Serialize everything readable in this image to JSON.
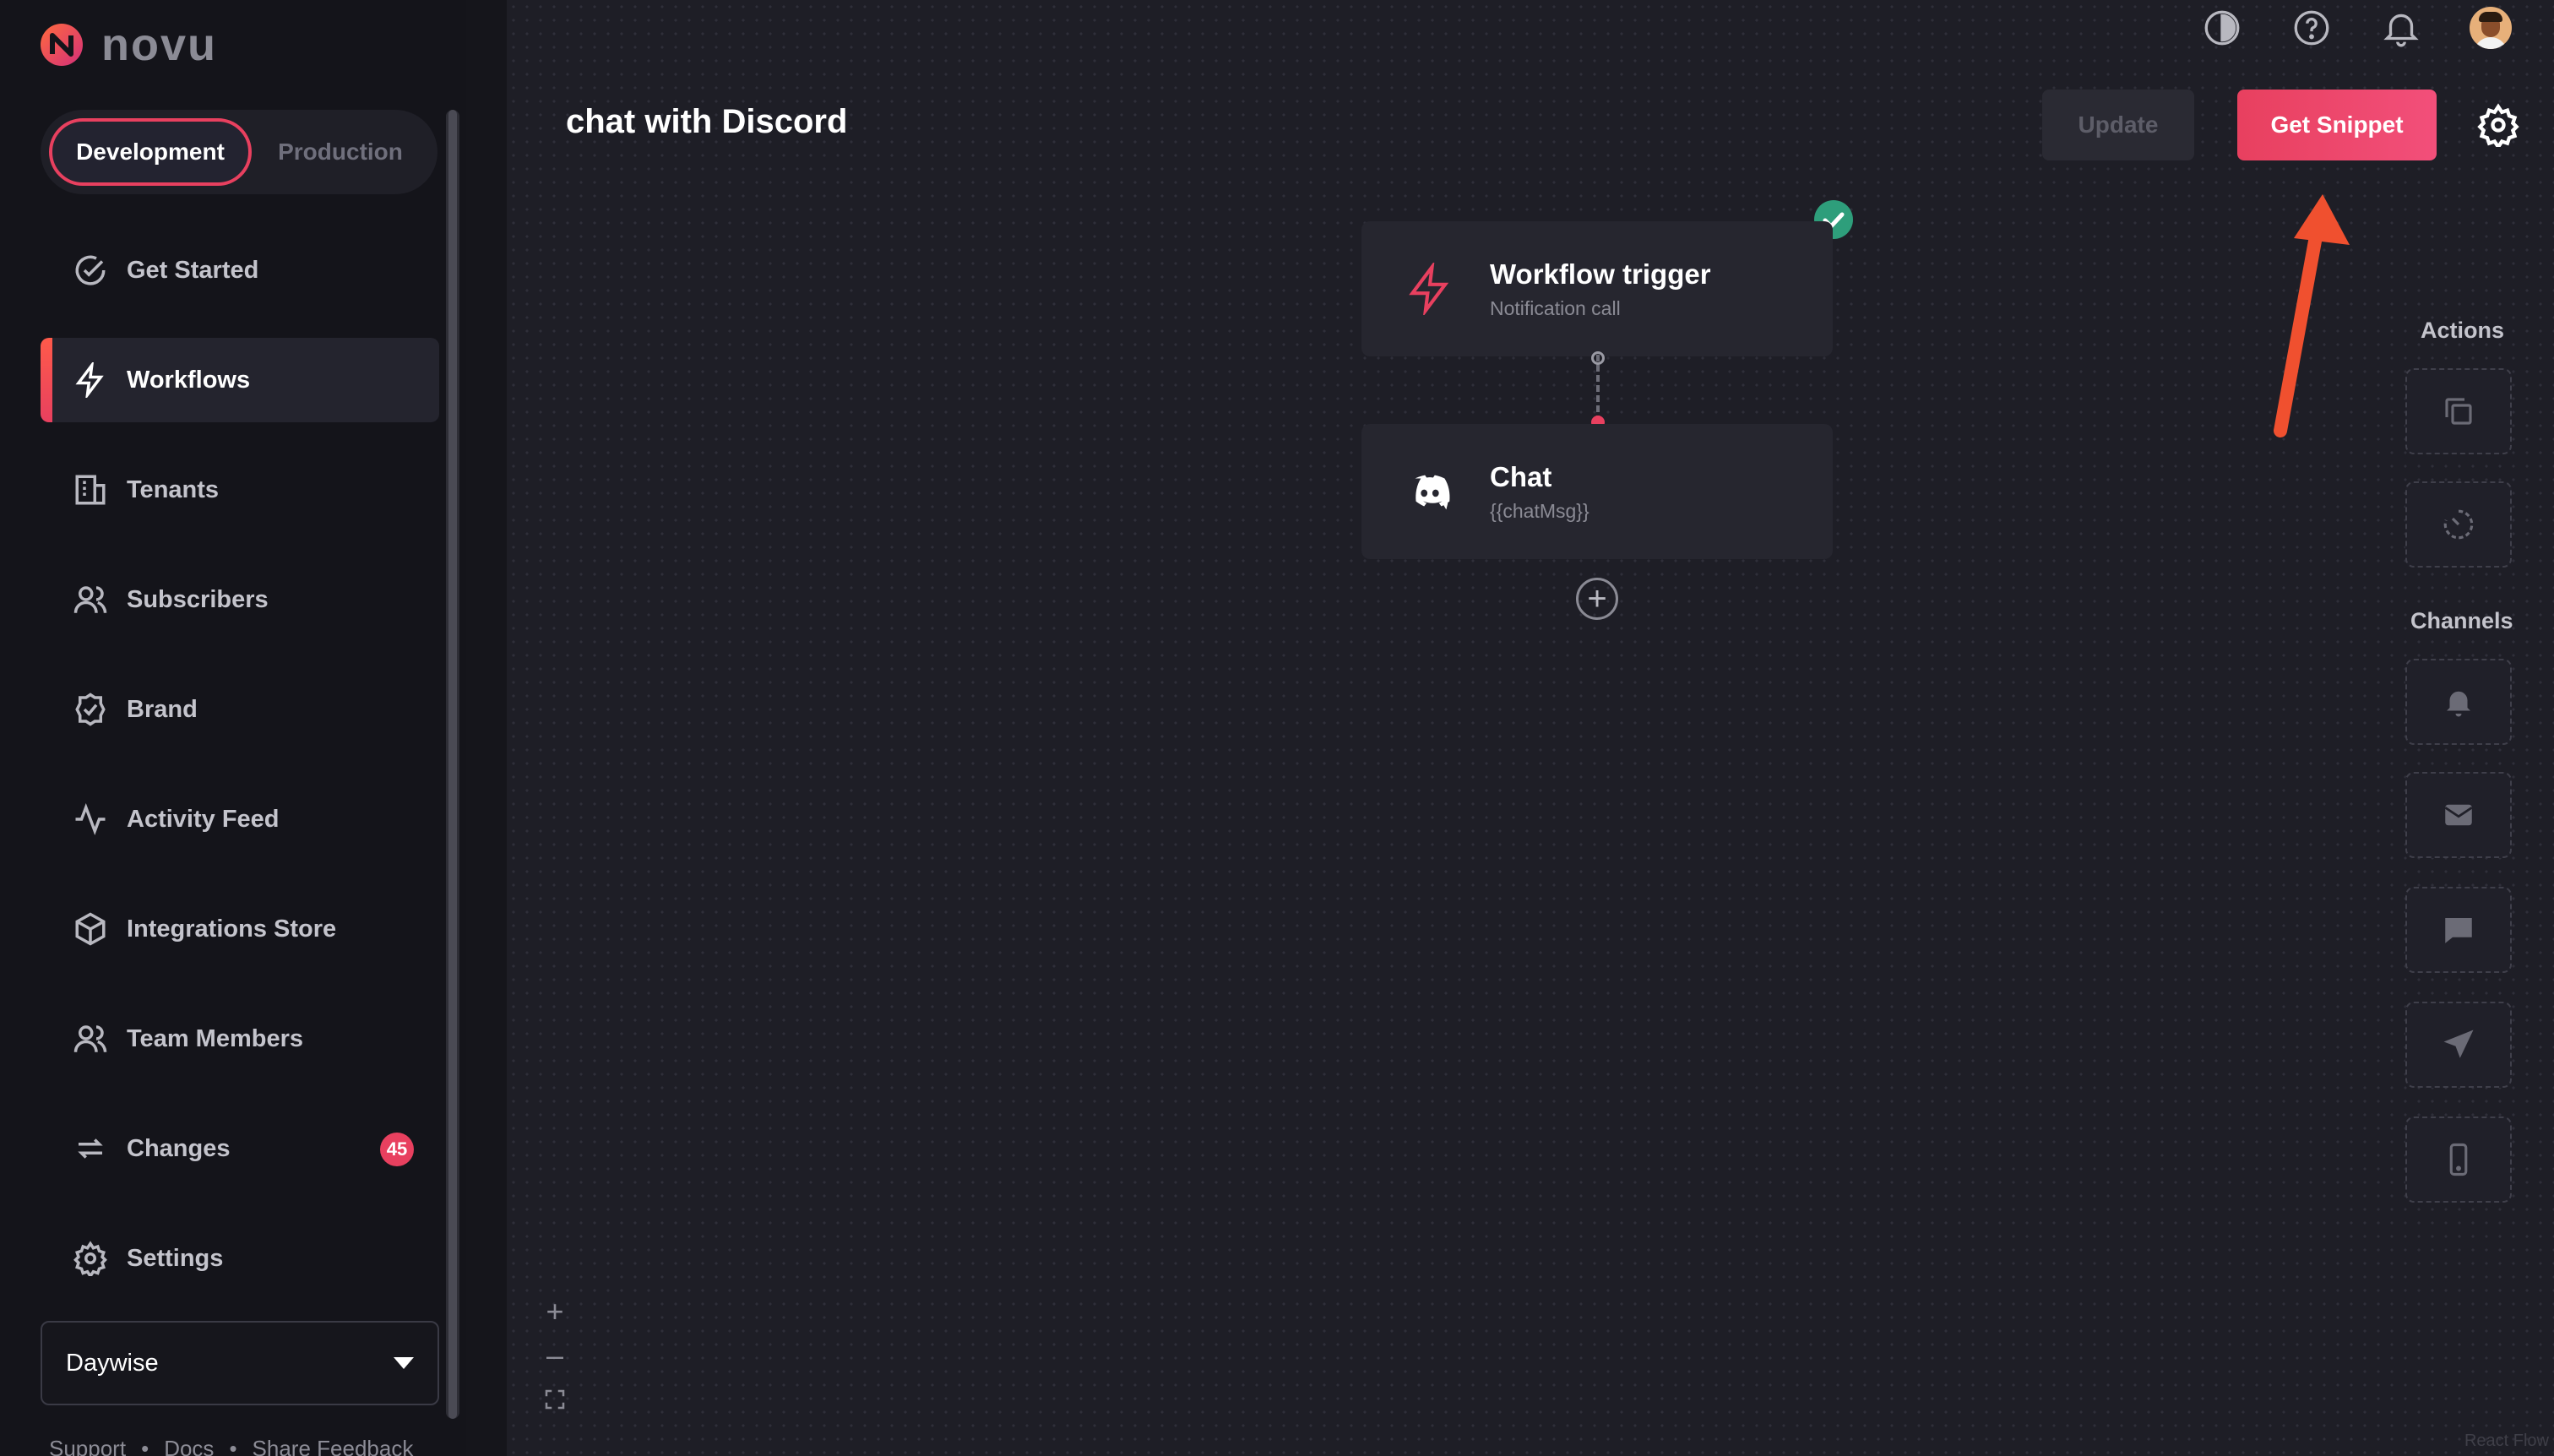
{
  "app": {
    "logo_text": "novu",
    "brand_color": "#e8405f"
  },
  "env": {
    "development": "Development",
    "production": "Production",
    "active": "Development"
  },
  "sidebar": {
    "items": [
      {
        "label": "Get Started",
        "icon": "check-circle-icon"
      },
      {
        "label": "Workflows",
        "icon": "bolt-icon"
      },
      {
        "label": "Tenants",
        "icon": "building-icon"
      },
      {
        "label": "Subscribers",
        "icon": "users-icon"
      },
      {
        "label": "Brand",
        "icon": "badge-check-icon"
      },
      {
        "label": "Activity Feed",
        "icon": "activity-icon"
      },
      {
        "label": "Integrations Store",
        "icon": "box-icon"
      },
      {
        "label": "Team Members",
        "icon": "team-icon"
      },
      {
        "label": "Changes",
        "icon": "refresh-icon",
        "badge": "45"
      },
      {
        "label": "Settings",
        "icon": "gear-icon"
      }
    ],
    "active": "Workflows",
    "organization": "Daywise",
    "footer": [
      "Support",
      "Docs",
      "Share Feedback"
    ]
  },
  "header": {
    "title": "chat with Discord",
    "update_label": "Update",
    "snippet_label": "Get Snippet"
  },
  "nodes": {
    "trigger": {
      "title": "Workflow trigger",
      "subtitle": "Notification call"
    },
    "chat": {
      "title": "Chat",
      "subtitle": "{{chatMsg}}"
    }
  },
  "panel": {
    "actions_label": "Actions",
    "channels_label": "Channels",
    "actions": [
      "digest-icon",
      "delay-icon"
    ],
    "channels": [
      "in-app-bell-icon",
      "email-icon",
      "chat-icon",
      "push-icon",
      "sms-icon"
    ]
  },
  "canvas": {
    "attribution": "React Flow"
  }
}
